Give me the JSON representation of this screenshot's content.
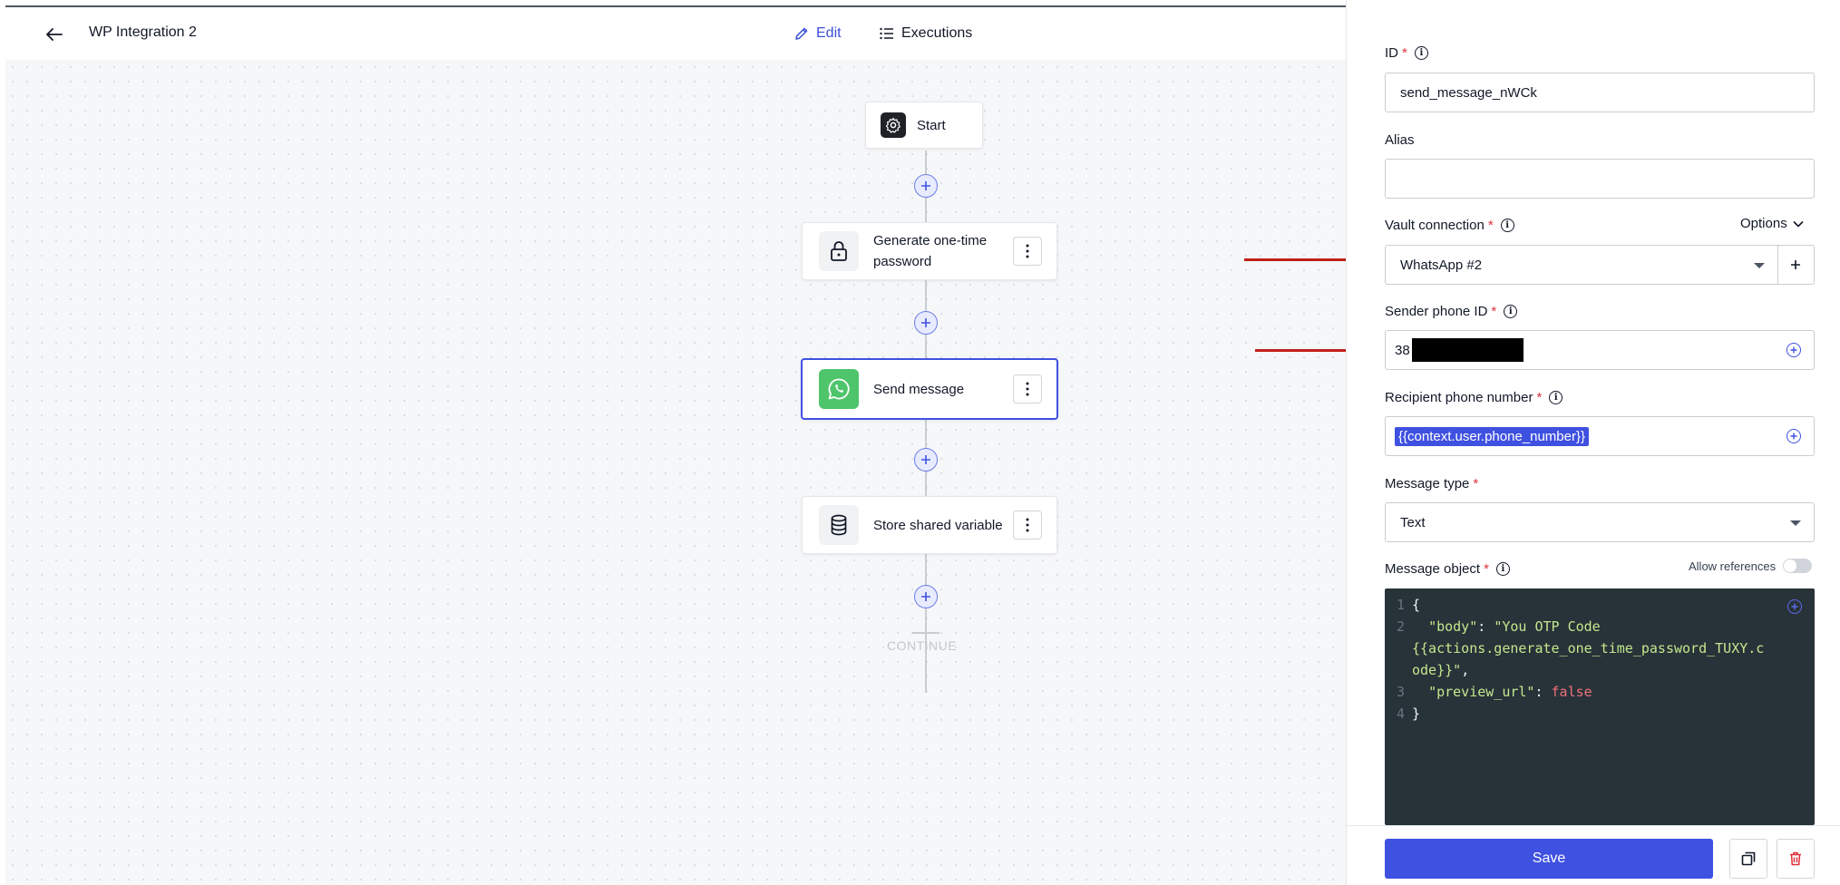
{
  "header": {
    "workflow_name": "WP Integration 2",
    "tabs": [
      {
        "label": "Edit",
        "active": true
      },
      {
        "label": "Executions",
        "active": false
      }
    ]
  },
  "canvas": {
    "start_label": "Start",
    "nodes": [
      {
        "label": "Generate one-time password",
        "icon": "lock-icon"
      },
      {
        "label": "Send message",
        "icon": "whatsapp-icon",
        "selected": true
      },
      {
        "label": "Store shared variable",
        "icon": "database-icon"
      }
    ],
    "continue_label": "CONTINUE"
  },
  "panel": {
    "id_label": "ID",
    "id_value": "send_message_nWCk",
    "alias_label": "Alias",
    "alias_value": "",
    "vault_label": "Vault connection",
    "options_label": "Options",
    "vault_value": "WhatsApp #2",
    "sender_label": "Sender phone ID",
    "sender_value": "38",
    "recipient_label": "Recipient phone number",
    "recipient_value": "{{context.user.phone_number}}",
    "message_type_label": "Message type",
    "message_type_value": "Text",
    "message_object_label": "Message object",
    "allow_refs_label": "Allow references",
    "code": {
      "line1": "{",
      "line2_key": "\"body\"",
      "line2_val": "\"You OTP Code",
      "line2_cont1": "{{actions.generate_one_time_password_TUXY.c",
      "line2_cont2": "ode}}\"",
      "line3_key": "\"preview_url\"",
      "line3_val": "false",
      "line4": "}"
    },
    "save_label": "Save"
  },
  "colors": {
    "accent": "#3f51e0",
    "whatsapp": "#4ec56b",
    "danger": "#e0303a",
    "arrow": "#c0201a"
  }
}
